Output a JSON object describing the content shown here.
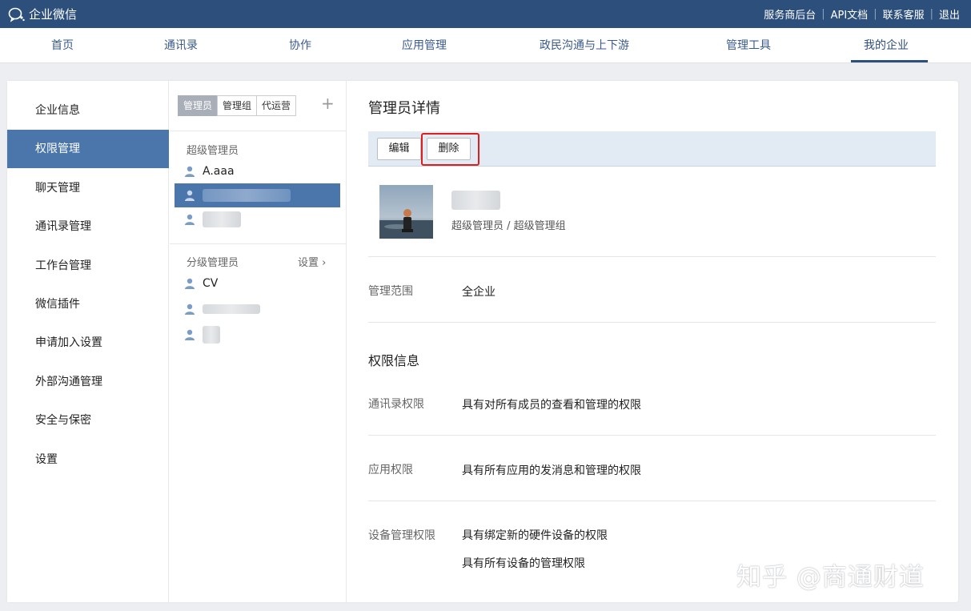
{
  "topbar": {
    "logo_text": "企业微信",
    "links": [
      "服务商后台",
      "API文档",
      "联系客服",
      "退出"
    ]
  },
  "nav": {
    "items": [
      "首页",
      "通讯录",
      "协作",
      "应用管理",
      "政民沟通与上下游",
      "管理工具",
      "我的企业"
    ],
    "active": "我的企业"
  },
  "sidebar": {
    "items": [
      "企业信息",
      "权限管理",
      "聊天管理",
      "通讯录管理",
      "工作台管理",
      "微信插件",
      "申请加入设置",
      "外部沟通管理",
      "安全与保密",
      "设置"
    ],
    "active": "权限管理"
  },
  "admin_list": {
    "tabs": [
      "管理员",
      "管理组",
      "代运营"
    ],
    "active_tab": "管理员",
    "super_label": "超级管理员",
    "super_admins": [
      "A.aaa",
      "",
      ""
    ],
    "sub_label": "分级管理员",
    "settings_label": "设置",
    "sub_admins": [
      "CV",
      "",
      ""
    ]
  },
  "detail": {
    "title": "管理员详情",
    "edit_label": "编辑",
    "delete_label": "删除",
    "role_text": "超级管理员 / 超级管理组",
    "scope_label": "管理范围",
    "scope_value": "全企业",
    "perm_title": "权限信息",
    "contacts_label": "通讯录权限",
    "contacts_value": "具有对所有成员的查看和管理的权限",
    "app_label": "应用权限",
    "app_value": "具有所有应用的发消息和管理的权限",
    "device_label": "设备管理权限",
    "device_value_1": "具有绑定新的硬件设备的权限",
    "device_value_2": "具有所有设备的管理权限"
  },
  "watermark": "知乎 @商通财道",
  "colors": {
    "topbar": "#2d4f7c",
    "accent": "#4a76ab",
    "highlight": "#d9201f"
  }
}
